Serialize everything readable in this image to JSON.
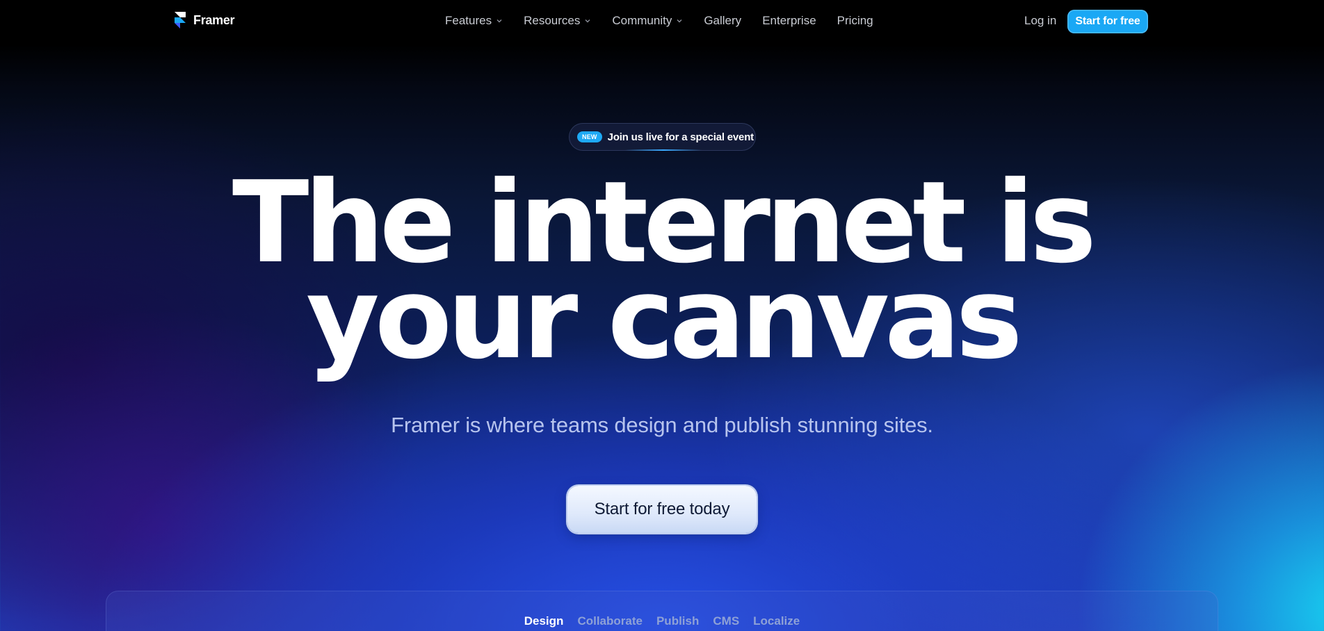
{
  "brand": {
    "name": "Framer"
  },
  "nav": {
    "items": [
      {
        "label": "Features",
        "dropdown": true
      },
      {
        "label": "Resources",
        "dropdown": true
      },
      {
        "label": "Community",
        "dropdown": true
      },
      {
        "label": "Gallery",
        "dropdown": false
      },
      {
        "label": "Enterprise",
        "dropdown": false
      },
      {
        "label": "Pricing",
        "dropdown": false
      }
    ],
    "login_label": "Log in",
    "cta_label": "Start for free"
  },
  "announcement": {
    "badge": "NEW",
    "text": "Join us live for a special event"
  },
  "hero": {
    "title_line1": "The internet is",
    "title_line2": "your canvas",
    "subtitle": "Framer is where teams design and publish stunning sites.",
    "cta_label": "Start for free today"
  },
  "showcase": {
    "tabs": [
      "Design",
      "Collaborate",
      "Publish",
      "CMS",
      "Localize"
    ],
    "active_tab": "Design"
  },
  "colors": {
    "accent": "#1aa8f5",
    "background_top": "#000000",
    "gradient_blue": "#2650e6",
    "gradient_cyan": "#18d2f0"
  }
}
